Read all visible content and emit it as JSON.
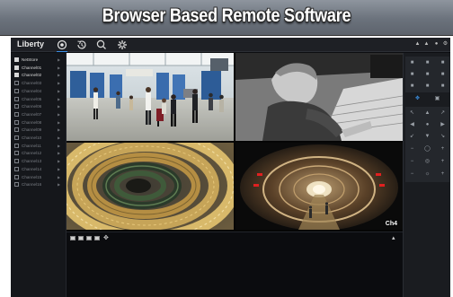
{
  "banner": {
    "title": "Browser Based Remote Software"
  },
  "app": {
    "brand": "Liberty",
    "top_icons": [
      "live-view-icon",
      "playback-icon",
      "search-icon",
      "settings-icon"
    ],
    "right_icons": [
      "user-icon",
      "lock-icon",
      "help-icon",
      "logout-icon"
    ]
  },
  "sidebar": {
    "items": [
      {
        "label": "NetStore",
        "active": true
      },
      {
        "label": "Channel01",
        "active": true
      },
      {
        "label": "Channel02",
        "active": true
      },
      {
        "label": "Channel03",
        "active": false
      },
      {
        "label": "Channel04",
        "active": false
      },
      {
        "label": "Channel05",
        "active": false
      },
      {
        "label": "Channel06",
        "active": false
      },
      {
        "label": "Channel07",
        "active": false
      },
      {
        "label": "Channel08",
        "active": false
      },
      {
        "label": "Channel09",
        "active": false
      },
      {
        "label": "Channel10",
        "active": false
      },
      {
        "label": "Channel11",
        "active": false
      },
      {
        "label": "Channel12",
        "active": false
      },
      {
        "label": "Channel13",
        "active": false
      },
      {
        "label": "Channel14",
        "active": false
      },
      {
        "label": "Channel15",
        "active": false
      },
      {
        "label": "Channel16",
        "active": false
      }
    ]
  },
  "video": {
    "tiles": [
      {
        "name": "airport-terminal-feed",
        "label": ""
      },
      {
        "name": "office-worker-feed",
        "label": ""
      },
      {
        "name": "spiral-staircase-feed",
        "label": ""
      },
      {
        "name": "subway-tunnel-feed",
        "label": "Ch4"
      }
    ]
  },
  "bottombar": {
    "layout_buttons": [
      "layout-1x1-button",
      "layout-2x2-button",
      "layout-3x3-button",
      "layout-4x4-button"
    ]
  },
  "colors": {
    "accent": "#3a8ee6",
    "background": "#0d0e11",
    "panel": "#1a1c20"
  }
}
